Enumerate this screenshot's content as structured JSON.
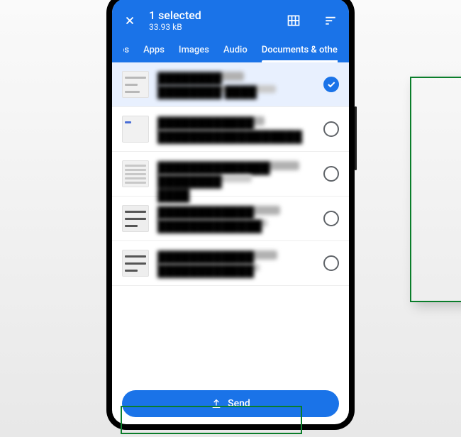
{
  "header": {
    "selected_count": "1 selected",
    "size": "33.93 kB"
  },
  "tabs": {
    "partial": "os",
    "items": [
      "Apps",
      "Images",
      "Audio",
      "Documents & other"
    ],
    "active_index": 3
  },
  "files": [
    {
      "selected": true,
      "thumb": "doc",
      "name": "████████",
      "detail": "████████ ████"
    },
    {
      "selected": false,
      "thumb": "plain",
      "name": "████████████",
      "detail": "██████████████████"
    },
    {
      "selected": false,
      "thumb": "dense",
      "name": "██████████████",
      "detail": "████████ ████"
    },
    {
      "selected": false,
      "thumb": "dark",
      "name": "████████████",
      "detail": "█████████████"
    },
    {
      "selected": false,
      "thumb": "dark",
      "name": "████████████",
      "detail": "████████████"
    }
  ],
  "footer": {
    "send_label": "Send"
  }
}
